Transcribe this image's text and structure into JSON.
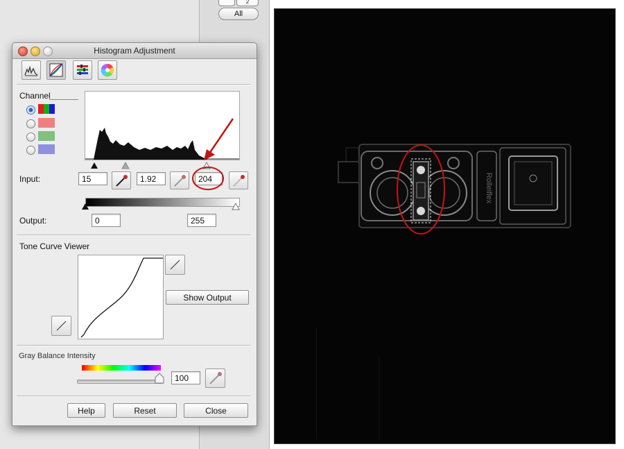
{
  "background_window": {
    "top_button_label": "2",
    "all_button_label": "All"
  },
  "panel": {
    "title": "Histogram Adjustment",
    "toolbar_icons": [
      "histogram-icon",
      "curves-icon",
      "levels-icon",
      "color-wheel-icon"
    ],
    "channel": {
      "label": "Channel",
      "options": [
        {
          "name": "rgb",
          "colors": [
            "#e02020",
            "#10b010",
            "#1a1ad0"
          ],
          "selected": true
        },
        {
          "name": "red",
          "colors": [
            "#f08080"
          ],
          "selected": false
        },
        {
          "name": "green",
          "colors": [
            "#80c080"
          ],
          "selected": false
        },
        {
          "name": "blue",
          "colors": [
            "#9090e0"
          ],
          "selected": false
        }
      ]
    },
    "input": {
      "label": "Input:",
      "black": "15",
      "gamma": "1.92",
      "white": "204"
    },
    "output": {
      "label": "Output:",
      "black": "0",
      "white": "255"
    },
    "tone_curve": {
      "label": "Tone Curve Viewer",
      "show_output_label": "Show Output"
    },
    "gray_balance": {
      "label": "Gray Balance Intensity",
      "value": "100"
    },
    "buttons": {
      "help": "Help",
      "reset": "Reset",
      "close": "Close"
    }
  },
  "annotation_colors": {
    "highlight": "#c41414"
  }
}
